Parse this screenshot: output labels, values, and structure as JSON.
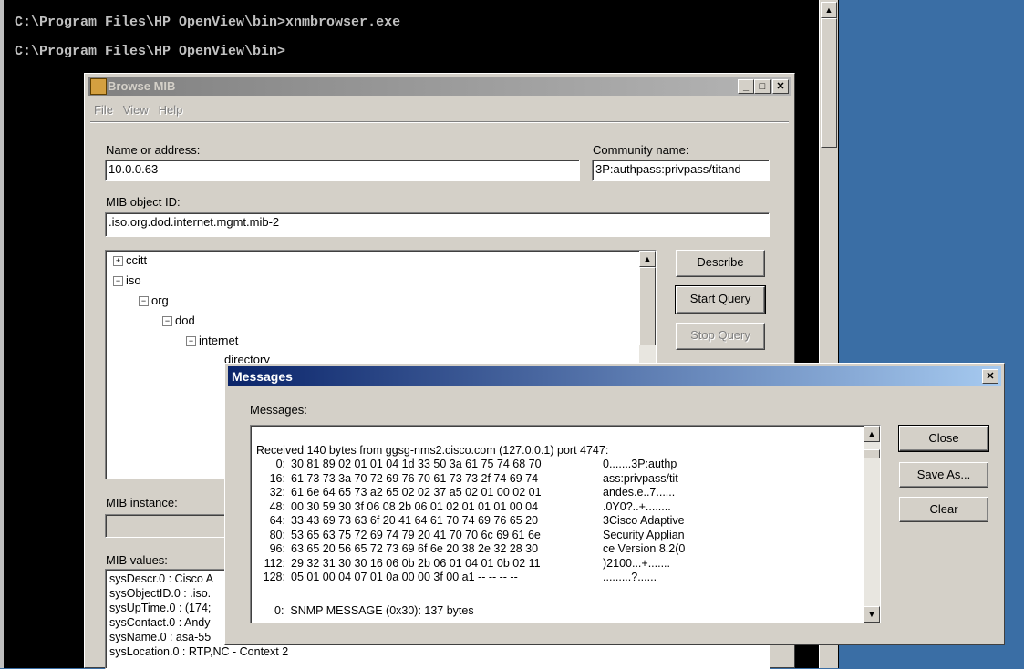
{
  "console": {
    "lines": [
      "C:\\Program Files\\HP OpenView\\bin>xnmbrowser.exe",
      "C:\\Program Files\\HP OpenView\\bin>"
    ]
  },
  "browse": {
    "title": "Browse MIB",
    "menu": [
      "File",
      "View",
      "Help"
    ],
    "name_label": "Name or address:",
    "name_value": "10.0.0.63",
    "community_label": "Community name:",
    "community_value": "3P:authpass:privpass/titand",
    "oid_label": "MIB object ID:",
    "oid_value": ".iso.org.dod.internet.mgmt.mib-2",
    "tree": [
      "ccitt",
      "iso",
      "org",
      "dod",
      "internet",
      "directory"
    ],
    "buttons": {
      "describe": "Describe",
      "start": "Start Query",
      "stop": "Stop Query"
    },
    "instance_label": "MIB instance:",
    "values_label": "MIB values:",
    "values": [
      "sysDescr.0 : Cisco A",
      "sysObjectID.0 : .iso.",
      "sysUpTime.0 : (174;",
      "sysContact.0 : Andy",
      "sysName.0 : asa-55",
      "sysLocation.0 : RTP,NC - Context 2"
    ]
  },
  "messages": {
    "title": "Messages",
    "label": "Messages:",
    "header": "Received 140 bytes from ggsg-nms2.cisco.com (127.0.0.1) port 4747:",
    "rows": [
      {
        "off": "0:",
        "hex": "30 81 89 02 01 01 04 1d 33 50 3a 61 75 74 68 70",
        "ascii": "0.......3P:authp"
      },
      {
        "off": "16:",
        "hex": "61 73 73 3a 70 72 69 76 70 61 73 73 2f 74 69 74",
        "ascii": "ass:privpass/tit"
      },
      {
        "off": "32:",
        "hex": "61 6e 64 65 73 a2 65 02 02 37 a5 02 01 00 02 01",
        "ascii": "andes.e..7......"
      },
      {
        "off": "48:",
        "hex": "00 30 59 30 3f 06 08 2b 06 01 02 01 01 01 00 04",
        "ascii": ".0Y0?..+........"
      },
      {
        "off": "64:",
        "hex": "33 43 69 73 63 6f 20 41 64 61 70 74 69 76 65 20",
        "ascii": "3Cisco Adaptive"
      },
      {
        "off": "80:",
        "hex": "53 65 63 75 72 69 74 79 20 41 70 70 6c 69 61 6e",
        "ascii": "Security Applian"
      },
      {
        "off": "96:",
        "hex": "63 65 20 56 65 72 73 69 6f 6e 20 38 2e 32 28 30",
        "ascii": "ce Version 8.2(0"
      },
      {
        "off": "112:",
        "hex": "29 32 31 30 30 16 06 0b 2b 06 01 04 01 0b 02 11",
        "ascii": ")2100...+......."
      },
      {
        "off": "128:",
        "hex": "05 01 00 04 07 01 0a 00 00 3f 00 a1 -- -- -- --",
        "ascii": ".........?......"
      }
    ],
    "footer": "0:  SNMP MESSAGE (0x30): 137 bytes",
    "buttons": {
      "close": "Close",
      "save": "Save As...",
      "clear": "Clear"
    }
  }
}
